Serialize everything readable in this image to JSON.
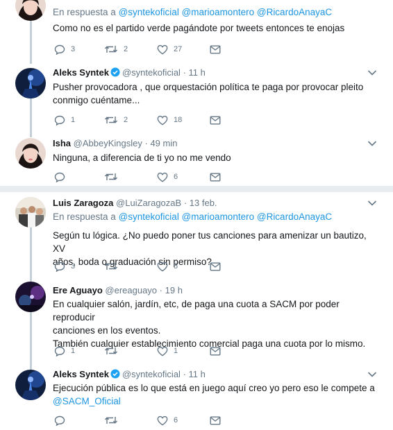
{
  "colors": {
    "accent": "#1b95e0",
    "muted": "#657786",
    "text": "#14171a",
    "separator": "#e6ecf0",
    "thread_line": "#c4d0d8"
  },
  "icons": {
    "reply": "reply-icon",
    "retweet": "retweet-icon",
    "like": "heart-icon",
    "message": "envelope-icon",
    "verified": "verified-badge-icon",
    "caret": "chevron-down-icon"
  },
  "tweets": [
    {
      "reply_prefix": "En respuesta a",
      "reply_mentions": [
        "@syntekoficial",
        "@marioamontero",
        "@RicardoAnayaC"
      ],
      "text": [
        "Como no es el partido verde pagándote por tweets entonces te enojas"
      ],
      "replies": "3",
      "retweets": "2",
      "likes": "27"
    },
    {
      "name": "Aleks Syntek",
      "handle": "@syntekoficial",
      "dot": "·",
      "time": "11 h",
      "text": [
        "Pusher provocadora , que orquestación política te paga por provocar pleito",
        "conmigo cuéntame..."
      ],
      "replies": "1",
      "retweets": "2",
      "likes": "18"
    },
    {
      "name": "Isha",
      "handle": "@AbbeyKingsley",
      "dot": "·",
      "time": "49 min",
      "text": [
        "Ninguna, a diferencia de ti yo no me vendo"
      ],
      "replies": "",
      "retweets": "",
      "likes": "6"
    },
    {
      "name": "Luis Zaragoza",
      "handle": "@LuiZaragozaB",
      "dot": "·",
      "time": "13 feb.",
      "reply_prefix": "En respuesta a",
      "reply_mentions": [
        "@syntekoficial",
        "@marioamontero",
        "@RicardoAnayaC"
      ],
      "text": [
        "Según tu lógica. ¿No puedo poner tus canciones para amenizar un bautizo, XV",
        "años, boda o graduación sin permiso?"
      ],
      "replies": "3",
      "retweets": "",
      "likes": "5"
    },
    {
      "name": "Ere Aguayo",
      "handle": "@ereaguayo",
      "dot": "·",
      "time": "19 h",
      "text": [
        "En cualquier salón, jardín, etc, de paga una cuota a SACM por poder reproducir",
        "canciones en los eventos.",
        "También cualquier establecimiento comercial paga una cuota por lo mismo."
      ],
      "replies": "1",
      "retweets": "",
      "likes": "1"
    },
    {
      "name": "Aleks Syntek",
      "handle": "@syntekoficial",
      "dot": "·",
      "time": "11 h",
      "text_line1": "Ejecución pública es lo que está en juego aquí creo yo pero eso le compete a",
      "text_mention": "@SACM_Oficial",
      "replies": "",
      "retweets": "",
      "likes": "6"
    }
  ]
}
